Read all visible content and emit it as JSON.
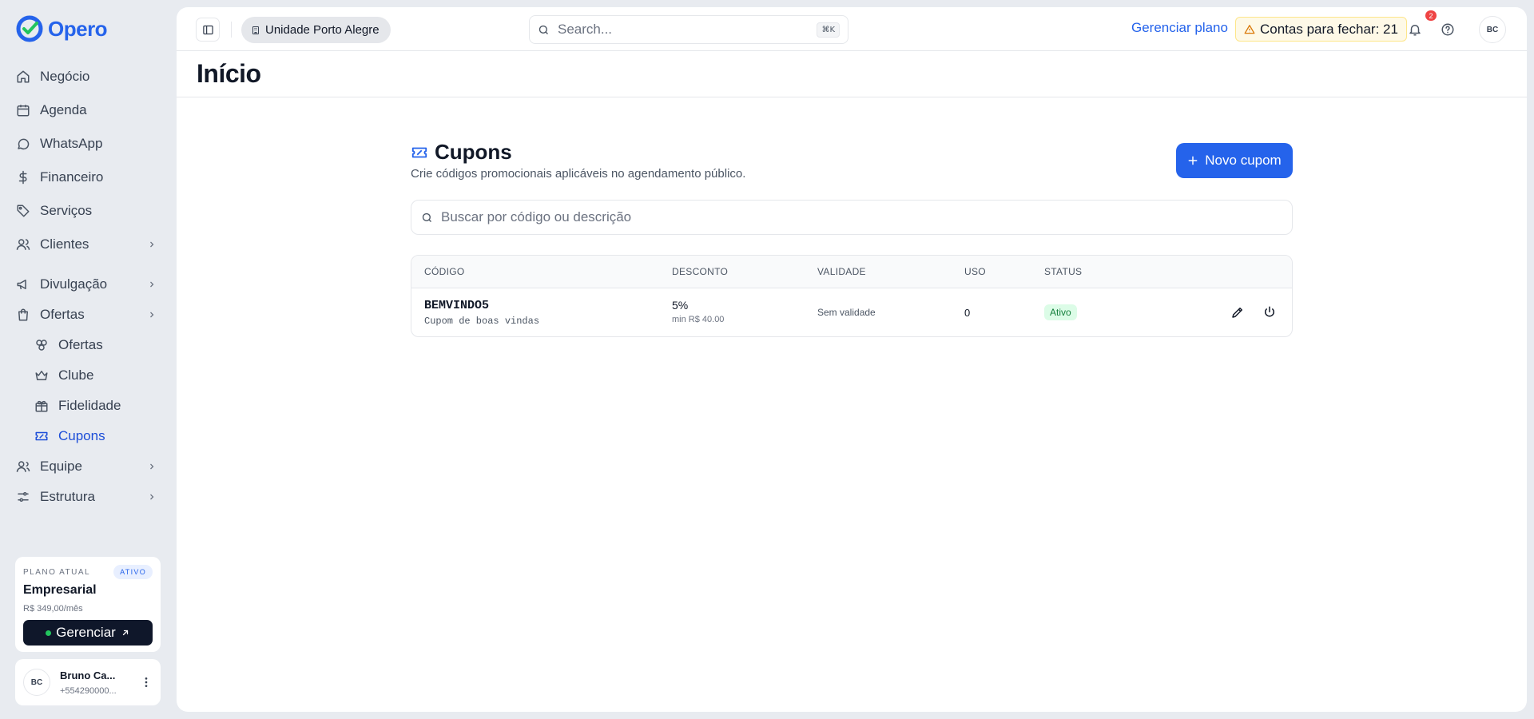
{
  "brand": {
    "name": "Opero",
    "color": "#2563eb"
  },
  "sidebar": {
    "items": [
      {
        "label": "Negócio",
        "icon": "home-icon"
      },
      {
        "label": "Agenda",
        "icon": "calendar-icon"
      },
      {
        "label": "WhatsApp",
        "icon": "chat-bubble-icon"
      },
      {
        "label": "Financeiro",
        "icon": "dollar-icon"
      },
      {
        "label": "Serviços",
        "icon": "tag-icon"
      },
      {
        "label": "Clientes",
        "icon": "users-icon",
        "expandable": true
      },
      {
        "label": "Divulgação",
        "icon": "megaphone-icon",
        "expandable": true
      },
      {
        "label": "Ofertas",
        "icon": "shopping-bag-icon",
        "expandable": true,
        "expanded": true
      },
      {
        "label": "Ofertas",
        "icon": "offers-icon",
        "sub": true
      },
      {
        "label": "Clube",
        "icon": "crown-icon",
        "sub": true
      },
      {
        "label": "Fidelidade",
        "icon": "gift-icon",
        "sub": true
      },
      {
        "label": "Cupons",
        "icon": "ticket-icon",
        "sub": true,
        "active": true
      },
      {
        "label": "Equipe",
        "icon": "team-icon",
        "expandable": true
      },
      {
        "label": "Estrutura",
        "icon": "sliders-icon",
        "expandable": true
      }
    ],
    "plan": {
      "label": "PLANO ATUAL",
      "badge": "ATIVO",
      "name": "Empresarial",
      "price": "R$ 349,00/mês",
      "button": "Gerenciar"
    },
    "user": {
      "initials": "BC",
      "name": "Bruno Ca...",
      "phone": "+554290000..."
    }
  },
  "topbar": {
    "unit": "Unidade Porto Alegre",
    "search_placeholder": "Search...",
    "shortcut": "⌘K",
    "plan_link": "Gerenciar plano",
    "bills_alert": "Contas para fechar: 21",
    "notifications_count": "2",
    "avatar_initials": "BC"
  },
  "page": {
    "title": "Início"
  },
  "coupons": {
    "title": "Cupons",
    "subtitle": "Crie códigos promocionais aplicáveis no agendamento público.",
    "new_button": "Novo cupom",
    "search_placeholder": "Buscar por código ou descrição",
    "columns": [
      "CÓDIGO",
      "DESCONTO",
      "VALIDADE",
      "USO",
      "STATUS"
    ],
    "rows": [
      {
        "code": "BEMVINDO5",
        "description": "Cupom de boas vindas",
        "discount": "5%",
        "min": "min R$ 40.00",
        "validity": "Sem validade",
        "usage": "0",
        "status": "Ativo"
      }
    ]
  },
  "colors": {
    "accent": "#2563eb",
    "success_bg": "#dcfce7",
    "success_text": "#15803d",
    "warning_bg": "#fef9e7",
    "danger": "#ef4444"
  }
}
